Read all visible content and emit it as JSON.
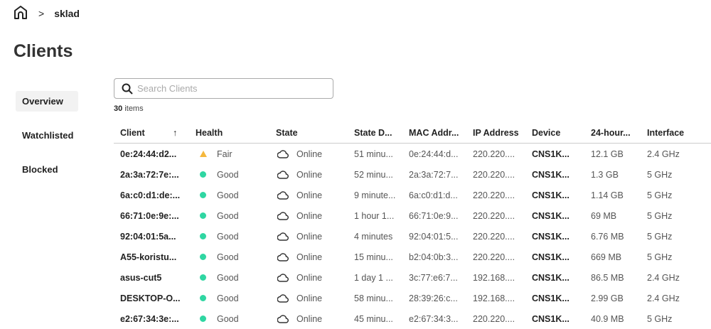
{
  "breadcrumb": {
    "current": "sklad"
  },
  "page_title": "Clients",
  "nav": [
    {
      "label": "Overview"
    },
    {
      "label": "Watchlisted"
    },
    {
      "label": "Blocked"
    }
  ],
  "search": {
    "placeholder": "Search Clients"
  },
  "count": {
    "number": "30",
    "label": "items"
  },
  "colors": {
    "good": "#2fd6a2",
    "fair": "#f5b83d"
  },
  "columns": [
    "Client",
    "Health",
    "State",
    "State D...",
    "MAC Addr...",
    "IP Address",
    "Device",
    "24-hour...",
    "Interface"
  ],
  "rows": [
    {
      "client": "0e:24:44:d2...",
      "health": "Fair",
      "state": "Online",
      "duration": "51 minu...",
      "mac": "0e:24:44:d...",
      "ip": "220.220....",
      "device": "CNS1K...",
      "usage": "12.1 GB",
      "iface": "2.4 GHz"
    },
    {
      "client": "2a:3a:72:7e:...",
      "health": "Good",
      "state": "Online",
      "duration": "52 minu...",
      "mac": "2a:3a:72:7...",
      "ip": "220.220....",
      "device": "CNS1K...",
      "usage": "1.3 GB",
      "iface": "5 GHz"
    },
    {
      "client": "6a:c0:d1:de:...",
      "health": "Good",
      "state": "Online",
      "duration": "9 minute...",
      "mac": "6a:c0:d1:d...",
      "ip": "220.220....",
      "device": "CNS1K...",
      "usage": "1.14 GB",
      "iface": "5 GHz"
    },
    {
      "client": "66:71:0e:9e:...",
      "health": "Good",
      "state": "Online",
      "duration": "1 hour 1...",
      "mac": "66:71:0e:9...",
      "ip": "220.220....",
      "device": "CNS1K...",
      "usage": "69 MB",
      "iface": "5 GHz"
    },
    {
      "client": "92:04:01:5a...",
      "health": "Good",
      "state": "Online",
      "duration": "4 minutes",
      "mac": "92:04:01:5...",
      "ip": "220.220....",
      "device": "CNS1K...",
      "usage": "6.76 MB",
      "iface": "5 GHz"
    },
    {
      "client": "A55-koristu...",
      "health": "Good",
      "state": "Online",
      "duration": "15 minu...",
      "mac": "b2:04:0b:3...",
      "ip": "220.220....",
      "device": "CNS1K...",
      "usage": "669 MB",
      "iface": "5 GHz"
    },
    {
      "client": "asus-cut5",
      "health": "Good",
      "state": "Online",
      "duration": "1 day 1 ...",
      "mac": "3c:77:e6:7...",
      "ip": "192.168....",
      "device": "CNS1K...",
      "usage": "86.5 MB",
      "iface": "2.4 GHz"
    },
    {
      "client": "DESKTOP-O...",
      "health": "Good",
      "state": "Online",
      "duration": "58 minu...",
      "mac": "28:39:26:c...",
      "ip": "192.168....",
      "device": "CNS1K...",
      "usage": "2.99 GB",
      "iface": "2.4 GHz"
    },
    {
      "client": "e2:67:34:3e:...",
      "health": "Good",
      "state": "Online",
      "duration": "45 minu...",
      "mac": "e2:67:34:3...",
      "ip": "220.220....",
      "device": "CNS1K...",
      "usage": "40.9 MB",
      "iface": "5 GHz"
    }
  ]
}
